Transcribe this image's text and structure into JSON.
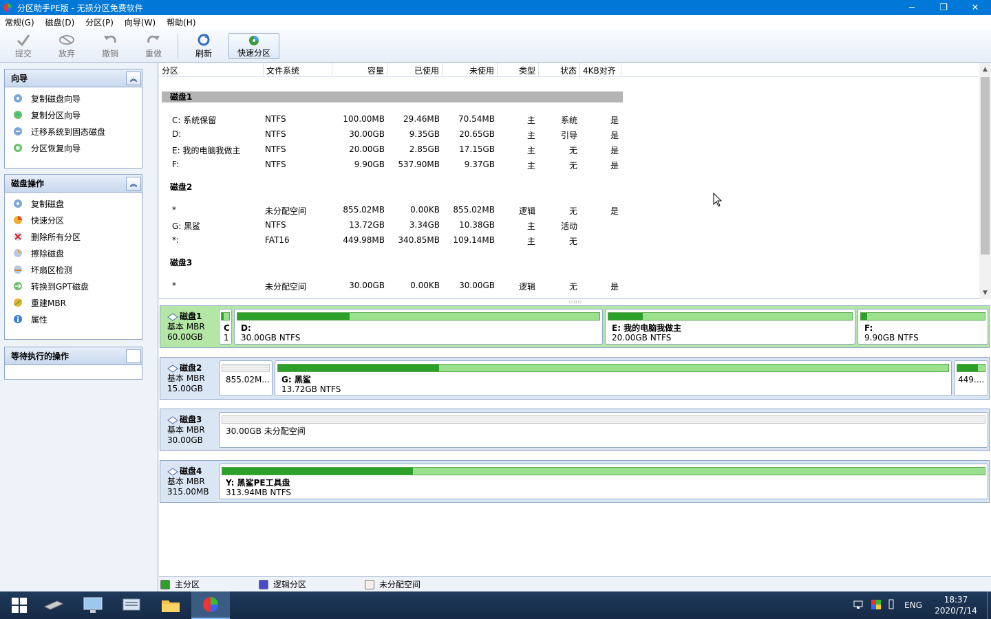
{
  "window": {
    "title": "分区助手PE版 - 无损分区免费软件",
    "controls": {
      "minimize": "─",
      "restore": "❐",
      "close": "✕"
    }
  },
  "menu": [
    "常规(G)",
    "磁盘(D)",
    "分区(P)",
    "向导(W)",
    "帮助(H)"
  ],
  "toolbar": {
    "submit": "提交",
    "discard": "放弃",
    "undo": "撤销",
    "redo": "重做",
    "refresh": "刷新",
    "quick_partition": "快速分区"
  },
  "sidebar": {
    "wizard": {
      "title": "向导",
      "items": [
        "复制磁盘向导",
        "复制分区向导",
        "迁移系统到固态磁盘",
        "分区恢复向导"
      ]
    },
    "disk_ops": {
      "title": "磁盘操作",
      "items": [
        "复制磁盘",
        "快速分区",
        "删除所有分区",
        "擦除磁盘",
        "坏扇区检测",
        "转换到GPT磁盘",
        "重建MBR",
        "属性"
      ]
    },
    "pending": {
      "title": "等待执行的操作"
    }
  },
  "table": {
    "columns": [
      "分区",
      "文件系统",
      "容量",
      "已使用",
      "未使用",
      "类型",
      "状态",
      "4KB对齐"
    ],
    "disks": [
      {
        "name": "磁盘1",
        "rows": [
          [
            "C: 系统保留",
            "NTFS",
            "100.00MB",
            "29.46MB",
            "70.54MB",
            "主",
            "系统",
            "是"
          ],
          [
            "D:",
            "NTFS",
            "30.00GB",
            "9.35GB",
            "20.65GB",
            "主",
            "引导",
            "是"
          ],
          [
            "E: 我的电脑我做主",
            "NTFS",
            "20.00GB",
            "2.85GB",
            "17.15GB",
            "主",
            "无",
            "是"
          ],
          [
            "F:",
            "NTFS",
            "9.90GB",
            "537.90MB",
            "9.37GB",
            "主",
            "无",
            "是"
          ]
        ]
      },
      {
        "name": "磁盘2",
        "rows": [
          [
            "*",
            "未分配空间",
            "855.02MB",
            "0.00KB",
            "855.02MB",
            "逻辑",
            "无",
            "是"
          ],
          [
            "G: 黑鲨",
            "NTFS",
            "13.72GB",
            "3.34GB",
            "10.38GB",
            "主",
            "活动",
            ""
          ],
          [
            "*:",
            "FAT16",
            "449.98MB",
            "340.85MB",
            "109.14MB",
            "主",
            "无",
            ""
          ]
        ]
      },
      {
        "name": "磁盘3",
        "rows": [
          [
            "*",
            "未分配空间",
            "30.00GB",
            "0.00KB",
            "30.00GB",
            "逻辑",
            "无",
            "是"
          ]
        ]
      }
    ]
  },
  "diskmap": [
    {
      "name": "磁盘1",
      "type": "基本 MBR",
      "size": "60.00GB",
      "parts": [
        {
          "label": "C",
          "info": "1",
          "used": 0.29
        },
        {
          "label": "D:",
          "info": "30.00GB NTFS",
          "used": 0.31
        },
        {
          "label": "E: 我的电脑我做主",
          "info": "20.00GB NTFS",
          "used": 0.14
        },
        {
          "label": "F:",
          "info": "9.90GB NTFS",
          "used": 0.05
        }
      ]
    },
    {
      "name": "磁盘2",
      "type": "基本 MBR",
      "size": "15.00GB",
      "parts": [
        {
          "label": "",
          "info": "855.02M...",
          "used": 0
        },
        {
          "label": "G: 黑鲨",
          "info": "13.72GB NTFS",
          "used": 0.24
        },
        {
          "label": "",
          "info": "449....",
          "used": 0.76
        }
      ]
    },
    {
      "name": "磁盘3",
      "type": "基本 MBR",
      "size": "30.00GB",
      "parts": [
        {
          "label": "",
          "info": "30.00GB 未分配空间",
          "used": 0
        }
      ]
    },
    {
      "name": "磁盘4",
      "type": "基本 MBR",
      "size": "315.00MB",
      "parts": [
        {
          "label": "Y: 黑鲨PE工具盘",
          "info": "313.94MB NTFS",
          "used": 0.25
        }
      ]
    }
  ],
  "legend": {
    "primary": "主分区",
    "logical": "逻辑分区",
    "unallocated": "未分配空间"
  },
  "colors": {
    "primary": "#2da02a",
    "logical": "#4a4ac8",
    "unallocated": "#f4f0e8",
    "accent": "#0078d7"
  },
  "taskbar": {
    "icons": [
      "windows-start-icon",
      "drive-icon",
      "computer-icon",
      "keyboard-icon",
      "folder-icon",
      "partition-assistant-icon"
    ],
    "lang": "ENG",
    "time": "18:37",
    "date": "2020/7/14"
  }
}
